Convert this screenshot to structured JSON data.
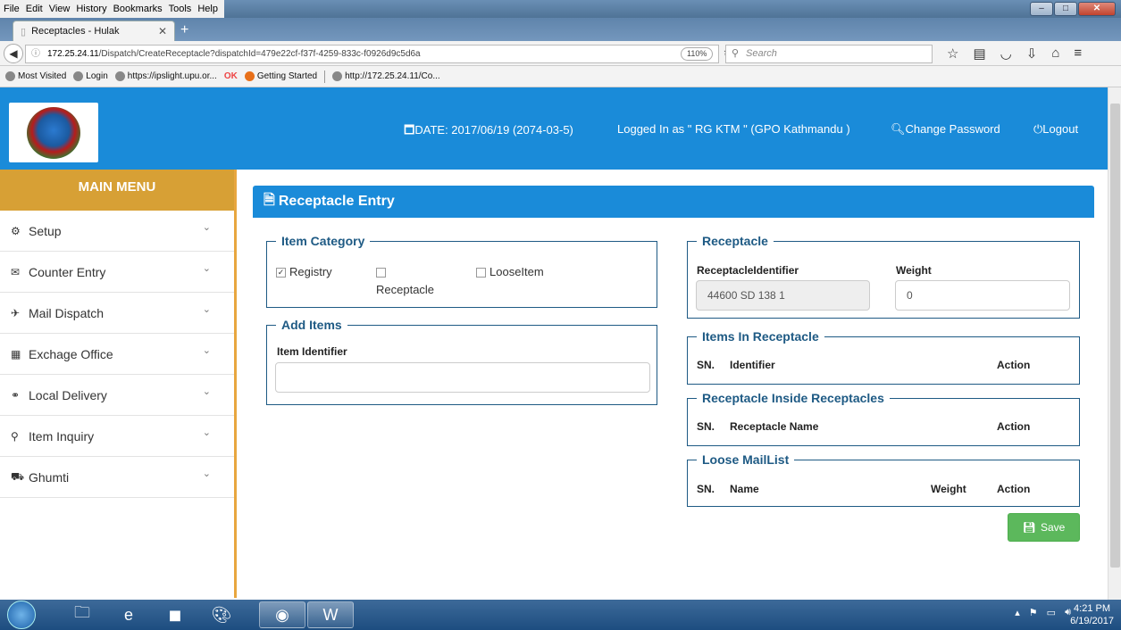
{
  "browser": {
    "menus": [
      "File",
      "Edit",
      "View",
      "History",
      "Bookmarks",
      "Tools",
      "Help"
    ],
    "tab_title": "Receptacles - Hulak",
    "url_host": "172.25.24.11",
    "url_path": "/Dispatch/CreateReceptacle?dispatchId=479e22cf-f37f-4259-833c-f0926d9c5d6a",
    "zoom": "110%",
    "search_placeholder": "Search",
    "bookmarks": [
      "Most Visited",
      "Login",
      "https://ipslight.upu.or...",
      "Getting Started",
      "http://172.25.24.11/Co..."
    ]
  },
  "header": {
    "date": "DATE: 2017/06/19 (2074-03-5)",
    "logged_in": "Logged In as \" RG KTM \" (GPO Kathmandu )",
    "change_password": "Change Password",
    "logout": "Logout"
  },
  "sidebar": {
    "title": "MAIN MENU",
    "items": [
      {
        "label": "Setup",
        "icon": "cogs-icon"
      },
      {
        "label": "Counter Entry",
        "icon": "envelope-icon"
      },
      {
        "label": "Mail Dispatch",
        "icon": "plane-icon"
      },
      {
        "label": "Exchage Office",
        "icon": "building-icon"
      },
      {
        "label": "Local Delivery",
        "icon": "bicycle-icon"
      },
      {
        "label": "Item Inquiry",
        "icon": "search-icon"
      },
      {
        "label": "Ghumti",
        "icon": "car-icon"
      }
    ]
  },
  "panel": {
    "title": "Receptacle Entry",
    "item_category": {
      "legend": "Item Category",
      "registry": "Registry",
      "registry_checked": true,
      "receptacle": "Receptacle",
      "looseitem": "LooseItem"
    },
    "add_items": {
      "legend": "Add Items",
      "label": "Item Identifier",
      "value": ""
    },
    "receptacle": {
      "legend": "Receptacle",
      "identifier_label": "ReceptacleIdentifier",
      "identifier_value": "44600  SD 138 1",
      "weight_label": "Weight",
      "weight_value": "0"
    },
    "items_in_receptacle": {
      "legend": "Items In Receptacle",
      "cols": [
        "SN.",
        "Identifier",
        "Action"
      ]
    },
    "receptacle_inside": {
      "legend": "Receptacle Inside Receptacles",
      "cols": [
        "SN.",
        "Receptacle Name",
        "Action"
      ]
    },
    "loose_maillist": {
      "legend": "Loose MailList",
      "cols": [
        "SN.",
        "Name",
        "Weight",
        "Action"
      ]
    },
    "save_label": "Save"
  },
  "taskbar": {
    "time": "4:21 PM",
    "date": "6/19/2017"
  }
}
